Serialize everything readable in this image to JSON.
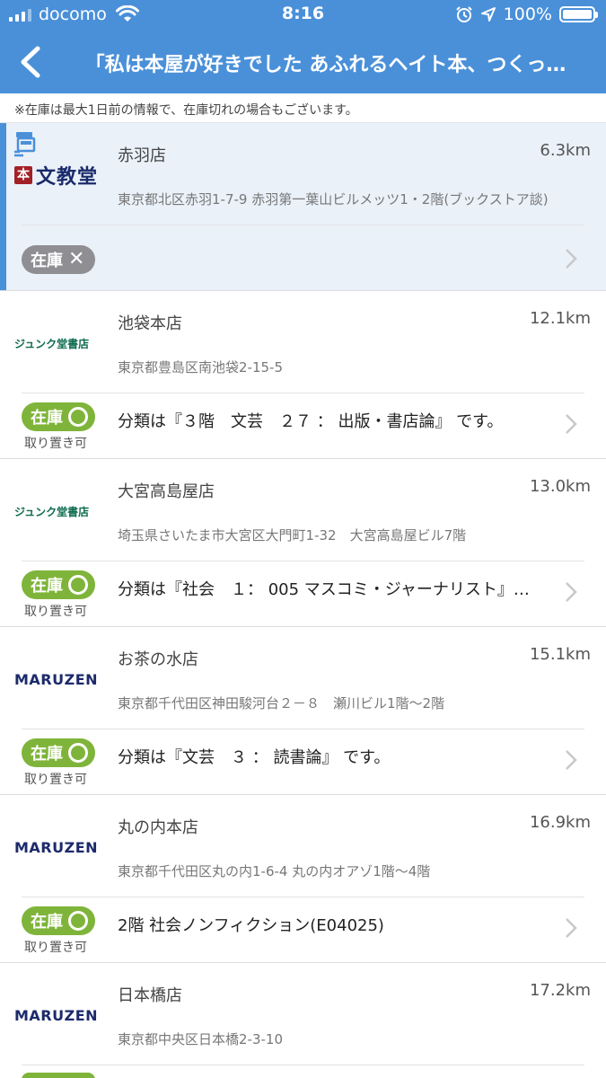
{
  "status_bar": {
    "carrier": "docomo",
    "time": "8:16",
    "battery": "100%",
    "icons": [
      "signal-icon",
      "wifi-icon",
      "alarm-icon",
      "location-arrow-icon",
      "battery-icon"
    ]
  },
  "nav": {
    "back_icon": "chevron-left-icon",
    "title": "「私は本屋が好きでした あふれるヘイト本、つくっ…"
  },
  "notice": "※在庫は最大1日前の情報で、在庫切れの場合もございます。",
  "labels": {
    "stock": "在庫",
    "reserve": "取り置き可"
  },
  "colors": {
    "brand_blue": "#4a90d9",
    "in_stock_green": "#7fb43a",
    "out_of_stock_gray": "#8e8e93"
  },
  "stores": [
    {
      "logo": "本 文教堂",
      "name": "赤羽店",
      "distance": "6.3km",
      "address": "東京都北区赤羽1-7-9 赤羽第一葉山ビルメッツ1・2階(ブックストア談)",
      "in_stock": false,
      "reservable": false,
      "category": ""
    },
    {
      "logo": "ジュンク堂書店",
      "name": "池袋本店",
      "distance": "12.1km",
      "address": "東京都豊島区南池袋2-15-5",
      "in_stock": true,
      "reservable": true,
      "category": "分類は『３階　文芸　２７ ： 出版・書店論』 です。"
    },
    {
      "logo": "ジュンク堂書店",
      "name": "大宮高島屋店",
      "distance": "13.0km",
      "address": "埼玉県さいたま市大宮区大門町1-32　大宮高島屋ビル7階",
      "in_stock": true,
      "reservable": true,
      "category": "分類は『社会　１： 005 マスコミ・ジャーナリスト』…"
    },
    {
      "logo": "MARUZEN",
      "name": "お茶の水店",
      "distance": "15.1km",
      "address": "東京都千代田区神田駿河台２－８　瀬川ビル1階～2階",
      "in_stock": true,
      "reservable": true,
      "category": "分類は『文芸　３ ： 読書論』 です。"
    },
    {
      "logo": "MARUZEN",
      "name": "丸の内本店",
      "distance": "16.9km",
      "address": "東京都千代田区丸の内1-6-4 丸の内オアゾ1階～4階",
      "in_stock": true,
      "reservable": true,
      "category": "2階 社会ノンフィクション(E04025)"
    },
    {
      "logo": "MARUZEN",
      "name": "日本橋店",
      "distance": "17.2km",
      "address": "東京都中央区日本橋2-3-10",
      "in_stock": true,
      "reservable": false,
      "category": ""
    }
  ]
}
